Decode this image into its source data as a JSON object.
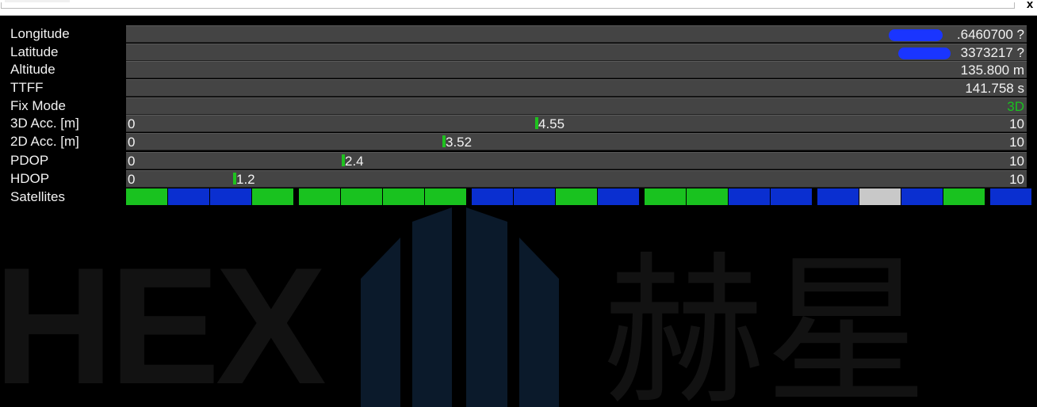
{
  "window": {
    "close_glyph": "x"
  },
  "watermark": {
    "brand_latin": "HEX",
    "brand_cjk": "赫星"
  },
  "info_rows": [
    {
      "label": "Longitude",
      "value": ".6460700 ?",
      "redacted": true
    },
    {
      "label": "Latitude",
      "value": "3373217 ?",
      "redacted": true
    },
    {
      "label": "Altitude",
      "value": "135.800 m",
      "redacted": false
    },
    {
      "label": "TTFF",
      "value": "141.758 s",
      "redacted": false
    },
    {
      "label": "Fix Mode",
      "value": "3D",
      "redacted": false,
      "value_color": "#19c21f"
    }
  ],
  "gauge_rows": [
    {
      "label": "3D Acc. [m]",
      "min": "0",
      "max": "10",
      "value": "4.55",
      "fraction": 0.455
    },
    {
      "label": "2D Acc. [m]",
      "min": "0",
      "max": "10",
      "value": "3.52",
      "fraction": 0.352
    },
    {
      "label": "PDOP",
      "min": "0",
      "max": "10",
      "value": "2.4",
      "fraction": 0.24
    },
    {
      "label": "HDOP",
      "min": "0",
      "max": "10",
      "value": "1.2",
      "fraction": 0.12
    }
  ],
  "satellites": {
    "label": "Satellites",
    "colors": {
      "green": "#19c21f",
      "blue": "#0a2fd0",
      "gray": "#c8c8c8"
    },
    "blocks": [
      "green",
      "blue",
      "blue",
      "green",
      "green",
      "green",
      "green",
      "green",
      "blue",
      "blue",
      "green",
      "blue",
      "green",
      "green",
      "blue",
      "blue",
      "blue",
      "gray",
      "blue",
      "green",
      "blue"
    ]
  }
}
